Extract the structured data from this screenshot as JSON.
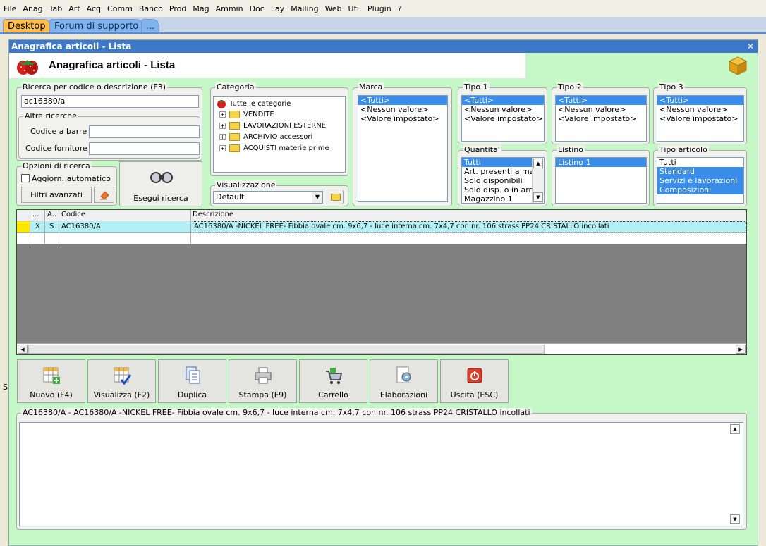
{
  "menu": [
    "File",
    "Anag",
    "Tab",
    "Art",
    "Acq",
    "Comm",
    "Banco",
    "Prod",
    "Mag",
    "Ammin",
    "Doc",
    "Lay",
    "Mailing",
    "Web",
    "Util",
    "Plugin",
    "?"
  ],
  "tabs": {
    "desktop": "Desktop",
    "forum": "Forum di supporto",
    "more": "..."
  },
  "window": {
    "title": "Anagrafica articoli  - Lista",
    "header": "Anagrafica articoli  - Lista",
    "close": "✕"
  },
  "search": {
    "group_label": "Ricerca per codice o descrizione (F3)",
    "value": "ac16380/a",
    "other_label": "Altre ricerche",
    "barcode_label": "Codice a barre :",
    "barcode_value": "",
    "supplier_label": "Codice fornitore :",
    "supplier_value": "",
    "options_label": "Opzioni di ricerca",
    "auto_update": "Aggiorn. automatico",
    "advanced_filters": "Filtri avanzati",
    "run_search": "Esegui ricerca"
  },
  "categoria": {
    "label": "Categoria",
    "root": "Tutte le categorie",
    "nodes": [
      "VENDITE",
      "LAVORAZIONI ESTERNE",
      "ARCHIVIO accessori",
      "ACQUISTI materie prime"
    ]
  },
  "visualizzazione": {
    "label": "Visualizzazione",
    "value": "Default"
  },
  "marca": {
    "label": "Marca",
    "items": [
      "<Tutti>",
      "<Nessun valore>",
      "<Valore impostato>"
    ],
    "selected": 0
  },
  "tipo1": {
    "label": "Tipo 1",
    "items": [
      "<Tutti>",
      "<Nessun valore>",
      "<Valore impostato>"
    ],
    "selected": 0
  },
  "tipo2": {
    "label": "Tipo 2",
    "items": [
      "<Tutti>",
      "<Nessun valore>",
      "<Valore impostato>"
    ],
    "selected": 0
  },
  "tipo3": {
    "label": "Tipo 3",
    "items": [
      "<Tutti>",
      "<Nessun valore>",
      "<Valore impostato>"
    ],
    "selected": 0
  },
  "quantita": {
    "label": "Quantita'",
    "items": [
      "Tutti",
      "Art. presenti a magazzino",
      "Solo disponibili",
      "Solo disp. o in arrivo",
      "Magazzino 1"
    ],
    "selected": 0
  },
  "listino": {
    "label": "Listino",
    "items": [
      "Listino 1"
    ],
    "selected": 0
  },
  "tipo_articolo": {
    "label": "Tipo articolo",
    "items": [
      "Tutti",
      "Standard",
      "Servizi e lavorazioni",
      "Composizioni"
    ],
    "selected": [
      1,
      2,
      3
    ]
  },
  "grid": {
    "headers": {
      "c1": "...",
      "c2": "A...",
      "code": "Codice",
      "desc": "Descrizione"
    },
    "rows": [
      {
        "c1": "X",
        "c2": "S",
        "code": "AC16380/A",
        "desc": "AC16380/A -NICKEL FREE- Fibbia ovale cm. 9x6,7 - luce interna cm. 7x4,7 con nr. 106 strass PP24 CRISTALLO incollati"
      }
    ]
  },
  "toolbar": {
    "new": "Nuovo (F4)",
    "view": "Visualizza (F2)",
    "duplicate": "Duplica",
    "print": "Stampa (F9)",
    "cart": "Carrello",
    "processing": "Elaborazioni",
    "exit": "Uscita (ESC)"
  },
  "notes": {
    "label": "AC16380/A - AC16380/A -NICKEL FREE- Fibbia ovale cm. 9x6,7 - luce interna cm. 7x4,7 con nr. 106 strass PP24 CRISTALLO incollati",
    "value": ""
  },
  "side_char": "S",
  "colors": {
    "accent": "#3a8eea",
    "window_bg": "#c6f7c6",
    "titlebar": "#3e78c8",
    "tab_active": "#ffbf4a",
    "row_selected": "#b3f0f6"
  }
}
